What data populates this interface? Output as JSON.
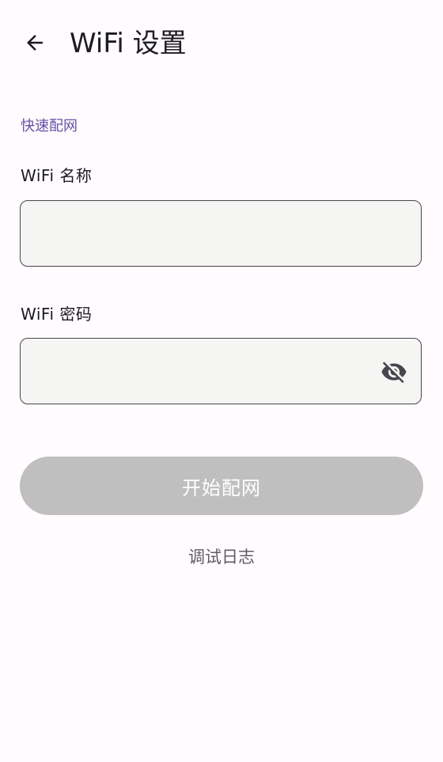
{
  "app_bar": {
    "title": "WiFi 设置",
    "back_icon": "arrow-back-icon"
  },
  "form": {
    "section_label": "快速配网",
    "ssid": {
      "label": "WiFi 名称",
      "value": "",
      "placeholder": ""
    },
    "password": {
      "label": "WiFi 密码",
      "value": "",
      "placeholder": "",
      "visibility_icon": "eye-off-icon"
    },
    "submit_label": "开始配网",
    "debug_log_label": "调试日志"
  },
  "colors": {
    "background": "#fffbfe",
    "accent": "#6750a4",
    "field_fill": "#f5f6f4",
    "field_border": "#49454f",
    "disabled_button": "#bfbfbf"
  }
}
